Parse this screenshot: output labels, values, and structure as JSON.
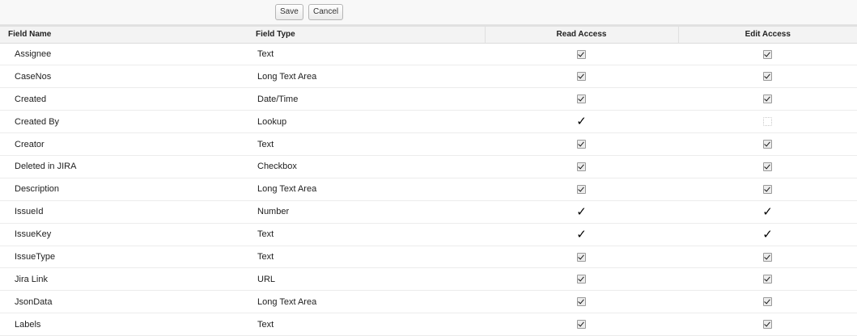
{
  "toolbar": {
    "save_label": "Save",
    "cancel_label": "Cancel"
  },
  "table": {
    "headers": {
      "field_name": "Field Name",
      "field_type": "Field Type",
      "read_access": "Read Access",
      "edit_access": "Edit Access"
    },
    "rows": [
      {
        "name": "Assignee",
        "type": "Text",
        "read": "checked",
        "edit": "checked"
      },
      {
        "name": "CaseNos",
        "type": "Long Text Area",
        "read": "checked",
        "edit": "checked"
      },
      {
        "name": "Created",
        "type": "Date/Time",
        "read": "checked",
        "edit": "checked"
      },
      {
        "name": "Created By",
        "type": "Lookup",
        "read": "tick",
        "edit": "empty"
      },
      {
        "name": "Creator",
        "type": "Text",
        "read": "checked",
        "edit": "checked"
      },
      {
        "name": "Deleted in JIRA",
        "type": "Checkbox",
        "read": "checked",
        "edit": "checked"
      },
      {
        "name": "Description",
        "type": "Long Text Area",
        "read": "checked",
        "edit": "checked"
      },
      {
        "name": "IssueId",
        "type": "Number",
        "read": "tick",
        "edit": "tick"
      },
      {
        "name": "IssueKey",
        "type": "Text",
        "read": "tick",
        "edit": "tick"
      },
      {
        "name": "IssueType",
        "type": "Text",
        "read": "checked",
        "edit": "checked"
      },
      {
        "name": "Jira Link",
        "type": "URL",
        "read": "checked",
        "edit": "checked"
      },
      {
        "name": "JsonData",
        "type": "Long Text Area",
        "read": "checked",
        "edit": "checked"
      },
      {
        "name": "Labels",
        "type": "Text",
        "read": "checked",
        "edit": "checked"
      }
    ]
  },
  "icons": {
    "tick_glyph": "✓"
  }
}
